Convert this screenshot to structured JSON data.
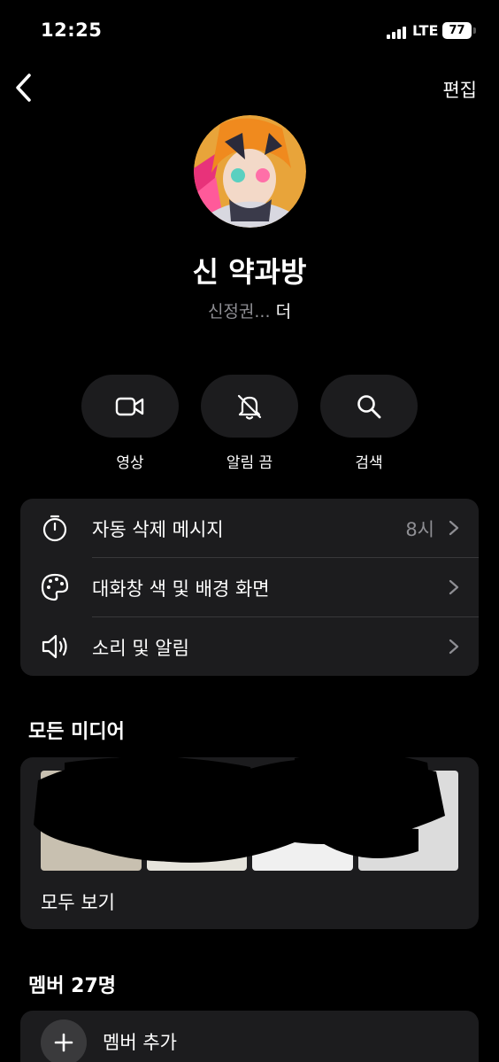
{
  "status_bar": {
    "time": "12:25",
    "network": "LTE",
    "battery": "77"
  },
  "nav": {
    "edit_label": "편집"
  },
  "profile": {
    "name": "신 약과방",
    "member_preview": "신정권...",
    "more_label": "더"
  },
  "actions": [
    {
      "label": "영상",
      "icon": "video-camera-icon"
    },
    {
      "label": "알림 끔",
      "icon": "bell-slash-icon"
    },
    {
      "label": "검색",
      "icon": "search-icon"
    }
  ],
  "settings": [
    {
      "label": "자동 삭제 메시지",
      "value": "8시",
      "icon": "timer-icon"
    },
    {
      "label": "대화창 색 및 배경 화면",
      "value": "",
      "icon": "palette-icon"
    },
    {
      "label": "소리 및 알림",
      "value": "",
      "icon": "speaker-icon"
    }
  ],
  "media": {
    "title": "모든 미디어",
    "see_all_label": "모두 보기"
  },
  "members": {
    "title": "멤버 27명",
    "add_label": "멤버 추가"
  },
  "colors": {
    "background": "#000000",
    "card": "#1c1c1e",
    "secondary_text": "#8e8e93",
    "divider": "#38383a"
  }
}
